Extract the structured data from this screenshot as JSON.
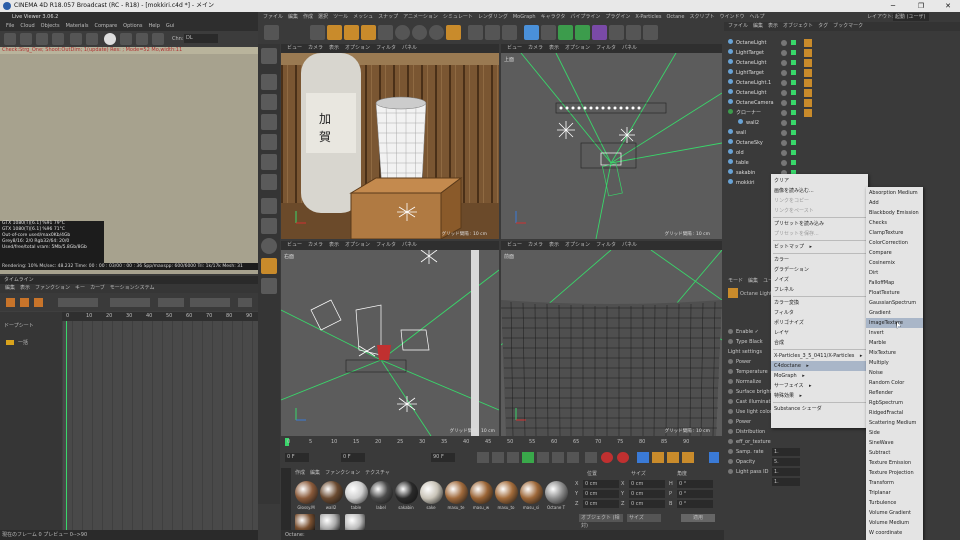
{
  "window": {
    "title": "CINEMA 4D R18.057 Broadcast (RC - R18) - [mokkiri.c4d *] - メイン",
    "minimize": "─",
    "maximize": "❐",
    "close": "✕"
  },
  "liveviewer": {
    "title": "Live Viewer 3.06.2",
    "menu": [
      "File",
      "Cloud",
      "Objects",
      "Materials",
      "Compare",
      "Options",
      "Help",
      "Gui"
    ],
    "channel": "Chn:",
    "channel_value": "DL",
    "status": "Check:Strg_One; Shoot:OutDim; 1(update) Res: ; Mode=52 Mo,width:11",
    "info": [
      "GTX 1080(T)[6.1]  %91  79°C",
      "GTX 1080(T)[6.1]  %96  71°C",
      "Out-of-core used/max0Kb/4Gb",
      "Grey8/16: 2/0       Rgb32/64: 20/0",
      "Used/free/total vram: 5Mb/5.8Gb/8Gb"
    ],
    "rendering": "Rendering: 10%   Ms/sec: 48.232   Time: 00 : 00 : 03/00 : 00 : 36   Spp/maxspp: 600/6000   Tri: 1k/17k   Mesh: 31"
  },
  "timeline": {
    "title": "タイムライン",
    "menu": [
      "編集",
      "表示",
      "ファンクション",
      "キー",
      "カーブ",
      "モーションシステム"
    ],
    "track": "ドープシート",
    "layer": "一括",
    "ticks": [
      "0",
      "10",
      "20",
      "30",
      "40",
      "50",
      "60",
      "70",
      "80",
      "90"
    ],
    "status": "現在のフレーム 0  プレビュー 0-->90"
  },
  "mainmenu": [
    "ファイル",
    "編集",
    "作成",
    "選択",
    "ツール",
    "メッシュ",
    "スナップ",
    "アニメーション",
    "シミュレート",
    "レンダリング",
    "MoGraph",
    "キャラクタ",
    "パイプライン",
    "プラグイン",
    "X-Particles",
    "Octane",
    "スクリプト",
    "ウインドウ",
    "ヘルプ"
  ],
  "layout": {
    "label": "レイアウト:",
    "value": "起動 (ユーザ)"
  },
  "viewports": [
    {
      "menu": [
        "ビュー",
        "カメラ",
        "表示",
        "オプション",
        "フィルタ",
        "パネル"
      ],
      "name": "",
      "grid": "グリッド間隔 : 10 cm"
    },
    {
      "menu": [
        "ビュー",
        "カメラ",
        "表示",
        "オプション",
        "フィルタ",
        "パネル"
      ],
      "name": "上面",
      "grid": "グリッド間隔 : 10 cm"
    },
    {
      "menu": [
        "ビュー",
        "カメラ",
        "表示",
        "オプション",
        "フィルタ",
        "パネル"
      ],
      "name": "右面",
      "grid": "グリッド間隔 : 10 cm"
    },
    {
      "menu": [
        "ビュー",
        "カメラ",
        "表示",
        "オプション",
        "フィルタ",
        "パネル"
      ],
      "name": "前面",
      "grid": "グリッド間隔 : 10 cm"
    }
  ],
  "ruler": [
    "0",
    "5",
    "10",
    "15",
    "20",
    "25",
    "30",
    "35",
    "40",
    "45",
    "50",
    "55",
    "60",
    "65",
    "70",
    "75",
    "80",
    "85",
    "90"
  ],
  "transport": {
    "frame": "0 F",
    "start": "0 F",
    "end": "90 F",
    "end2": "90 F"
  },
  "materials": {
    "menu": [
      "作成",
      "編集",
      "ファンクション",
      "テクスチャ"
    ],
    "items": [
      {
        "label": "Glossy.M",
        "color": "#8a5a3a"
      },
      {
        "label": "wall2",
        "color": "#6a4a30"
      },
      {
        "label": "table",
        "color": "#cfcfcf"
      },
      {
        "label": "label",
        "color": "#4a4a4a"
      },
      {
        "label": "sakabin",
        "color": "#2a2a2a"
      },
      {
        "label": "sake",
        "color": "#c9c4b8"
      },
      {
        "label": "masu_te",
        "color": "#a06a3c"
      },
      {
        "label": "masu_w",
        "color": "#9a6435"
      },
      {
        "label": "masu_to",
        "color": "#a36c3b"
      },
      {
        "label": "masu_si",
        "color": "#9d6738"
      },
      {
        "label": "Octane T",
        "color": "#8d8d8d"
      }
    ],
    "row2": [
      {
        "label": "",
        "color": "#7a5030"
      },
      {
        "label": "",
        "color": "#aaaaaa"
      },
      {
        "label": "",
        "color": "#bbbbbb"
      }
    ]
  },
  "coords": {
    "head": [
      "位置",
      "サイズ",
      "角度"
    ],
    "rows": [
      [
        "X",
        "0 cm",
        "X",
        "0 cm",
        "H",
        "0 °"
      ],
      [
        "Y",
        "0 cm",
        "Y",
        "0 cm",
        "P",
        "0 °"
      ],
      [
        "Z",
        "0 cm",
        "Z",
        "0 cm",
        "B",
        "0 °"
      ]
    ],
    "mode": "オブジェクト (相対)",
    "size_mode": "サイズ",
    "apply": "適用"
  },
  "objects": {
    "menu": [
      "ファイル",
      "編集",
      "表示",
      "オブジェクト",
      "タグ",
      "ブックマーク"
    ],
    "items": [
      "OctaneLight",
      "LightTarget",
      "OctaneLight",
      "LightTarget",
      "OctaneLight.1",
      "OctaneLight",
      "OctaneCamera",
      "クローナー",
      "wall2",
      "wall",
      "OctaneSky",
      "old",
      "table",
      "sakabin",
      "mokkiri"
    ]
  },
  "attributes": {
    "tabs": [
      "モード",
      "編集",
      "ユーザデータ"
    ],
    "header": "Octane Light Tag [オクタンライトタグ]",
    "rows": [
      "Enable ✓",
      "Type  Black",
      "Light settings",
      "Power",
      "Temperature",
      "Normalize",
      "Surface brightness",
      "Cast illumination",
      "Use light color",
      "Power",
      "Distribution",
      "eff_or_texture",
      "Samp. rate",
      "Opacity",
      "Light pass ID"
    ],
    "values": [
      "1.",
      "5.",
      "1.",
      "1."
    ]
  },
  "ctx1": {
    "items": [
      "クリア",
      "画像を読み込む...",
      "リンクをコピー",
      "リンクをペースト",
      "",
      "プリセットを読み込み",
      "プリセットを保存...",
      "",
      "ビットマップ",
      "",
      "カラー",
      "グラデーション",
      "ノイズ",
      "フレネル",
      "",
      "カラー変換",
      "フィルタ",
      "ポリゴナイズ",
      "レイヤ",
      "合成",
      "",
      "X-Particles_3_5_0411/X-Particles",
      "C4doctane",
      "MoGraph",
      "サーフェイス",
      "特殊効果",
      "",
      "Substance シェーダ"
    ],
    "disabled": [
      2,
      3,
      6
    ],
    "submenu": [
      8,
      21,
      22,
      23,
      24,
      25
    ],
    "highlight": 22
  },
  "ctx2": {
    "items": [
      "Absorption Medium",
      "Add",
      "Blackbody Emission",
      "Checks",
      "ClampTexture",
      "ColorCorrection",
      "Compare",
      "Cosinemix",
      "Dirt",
      "FalloffMap",
      "FloatTexture",
      "GaussianSpectrum",
      "Gradient",
      "ImageTexture",
      "Invert",
      "Marble",
      "MixTexture",
      "Multiply",
      "Noise",
      "Random Color",
      "Reflender",
      "RgbSpectrum",
      "RidgedFractal",
      "Scattering Medium",
      "Side",
      "SineWave",
      "Subtract",
      "Texture Emission",
      "Texture Projection",
      "Transform",
      "Triplanar",
      "Turbulence",
      "Volume Gradient",
      "Volume Medium",
      "W coordinate"
    ],
    "highlight": 13
  },
  "footer": {
    "octane": "Octane:"
  },
  "colors": {
    "green": "#39d66a",
    "vpbg": "#5c5c5c",
    "wood": "#5b3e24",
    "menubg": "#e4e4e4",
    "highlight": "#a9b6c8"
  }
}
